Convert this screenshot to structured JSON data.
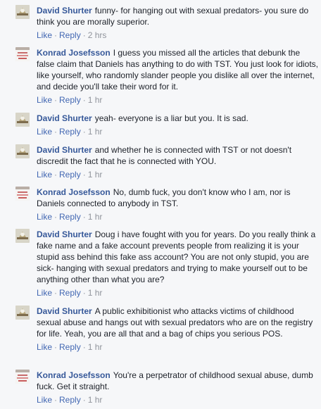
{
  "comments": [
    {
      "author": "David Shurter",
      "avatar": "david-shurter-avatar",
      "text": "funny- for hanging out with sexual predators- you sure do think you are morally superior.",
      "like_label": "Like",
      "reply_label": "Reply",
      "time": "2 hrs"
    },
    {
      "author": "Konrad Josefsson",
      "avatar": "konrad-josefsson-avatar",
      "text": "I guess you missed all the articles that debunk the false claim that Daniels has anything to do with TST. You just look for idiots, like yourself, who randomly slander people you dislike all over the internet, and decide you'll take their word for it.",
      "like_label": "Like",
      "reply_label": "Reply",
      "time": "1 hr"
    },
    {
      "author": "David Shurter",
      "avatar": "david-shurter-avatar",
      "text": "yeah- everyone is a liar but you. It is sad.",
      "like_label": "Like",
      "reply_label": "Reply",
      "time": "1 hr"
    },
    {
      "author": "David Shurter",
      "avatar": "david-shurter-avatar",
      "text": "and whether he is connected with TST or not doesn't discredit the fact that he is connected with YOU.",
      "like_label": "Like",
      "reply_label": "Reply",
      "time": "1 hr"
    },
    {
      "author": "Konrad Josefsson",
      "avatar": "konrad-josefsson-avatar",
      "text": "No, dumb fuck, you don't know who I am, nor is Daniels connected to anybody in TST.",
      "like_label": "Like",
      "reply_label": "Reply",
      "time": "1 hr"
    },
    {
      "author": "David Shurter",
      "avatar": "david-shurter-avatar",
      "text": "Doug i have fought with you for years. Do you really think a fake name and a fake account prevents people from realizing it is your stupid ass behind this fake ass account? You are not only stupid, you are sick- hanging with sexual predators and trying to make yourself out to be anything other than what you are?",
      "like_label": "Like",
      "reply_label": "Reply",
      "time": "1 hr"
    },
    {
      "author": "David Shurter",
      "avatar": "david-shurter-avatar",
      "text": "A public exhibitionist who attacks victims of childhood sexual abuse and hangs out with sexual predators who are on the registry for life. Yeah, you are all that and a bag of chips you serious POS.",
      "like_label": "Like",
      "reply_label": "Reply",
      "time": "1 hr"
    },
    {
      "author": "Konrad Josefsson",
      "avatar": "konrad-josefsson-avatar",
      "text": "You're a perpetrator of childhood sexual abuse, dumb fuck. Get it straight.",
      "like_label": "Like",
      "reply_label": "Reply",
      "time": "1 hr"
    }
  ],
  "meta_separator": "·",
  "colors": {
    "author": "#365899",
    "body_text": "#1d2129",
    "action_link": "#4267b2",
    "muted": "#90949c",
    "background": "#f6f7f9"
  }
}
